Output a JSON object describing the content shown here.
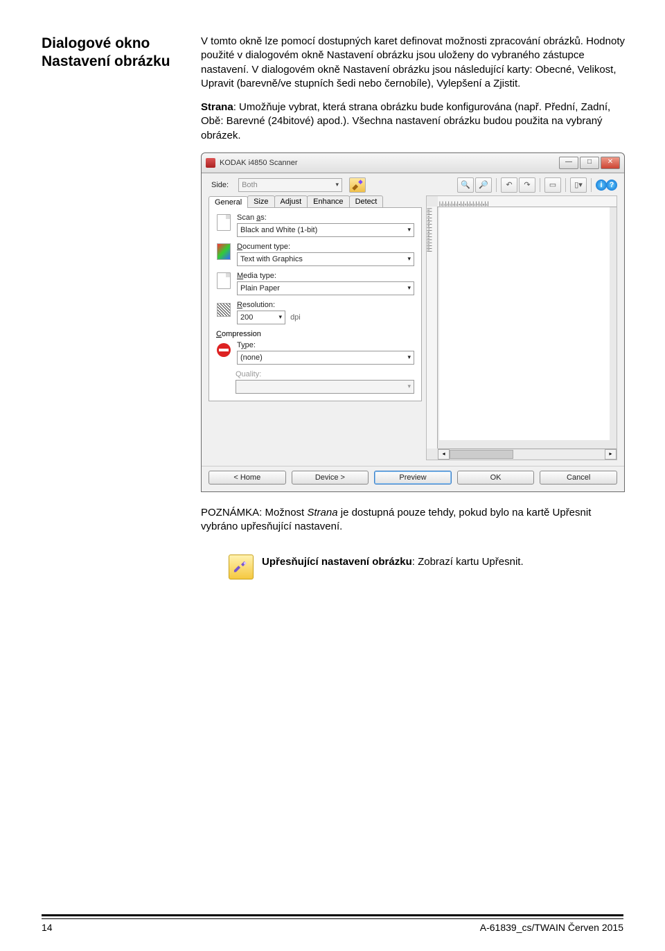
{
  "heading_line1": "Dialogové okno",
  "heading_line2": "Nastavení obrázku",
  "para1": "V tomto okně lze pomocí dostupných karet definovat možnosti zpracování obrázků. Hodnoty použité v dialogovém okně Nastavení obrázku jsou uloženy do vybraného zástupce nastavení. V dialogovém okně Nastavení obrázku jsou následující karty: Obecné, Velikost, Upravit (barevně/ve stupních šedi nebo černobíle), Vylepšení a Zjistit.",
  "para2_pre": "Strana",
  "para2_mid": ": Umožňuje vybrat, která strana obrázku bude konfigurována (např. Přední, Zadní, Obě: Barevné (24bitové) apod.). Všechna nastavení obrázku budou použita na vybraný obrázek.",
  "window": {
    "title": "KODAK i4850 Scanner",
    "side_label": "Side:",
    "side_value": "Both",
    "tabs": [
      "General",
      "Size",
      "Adjust",
      "Enhance",
      "Detect"
    ],
    "scan_as_label": "Scan as:",
    "scan_as_value": "Black and White (1-bit)",
    "doc_type_label": "Document type:",
    "doc_type_value": "Text with Graphics",
    "media_label": "Media type:",
    "media_value": "Plain Paper",
    "res_label": "Resolution:",
    "res_value": "200",
    "dpi": "dpi",
    "compression_label": "Compression",
    "type_label": "Type:",
    "type_value": "(none)",
    "quality_label": "Quality:",
    "ruler_h": "|₁|₁|₂|₁|₃|₁|₄|₁|₅|₁|₆|₁|₇|₁|₈|₁|",
    "ruler_v": "|₁|₂|₃|₄|₅|₆|₇|₈|₉|₁|₁|₁|₁|₁|",
    "buttons": {
      "home": "< Home",
      "device": "Device >",
      "preview": "Preview",
      "ok": "OK",
      "cancel": "Cancel"
    }
  },
  "note_label": "POZNÁMKA: ",
  "note_body_pre": "Možnost ",
  "note_body_em": "Strana",
  "note_body_post": " je dostupná pouze tehdy, pokud bylo na kartě Upřesnit vybráno upřesňující nastavení.",
  "advset_b": "Upřesňující nastavení obrázku",
  "advset_rest": ": Zobrazí kartu Upřesnit.",
  "footer_left": "14",
  "footer_right": "A-61839_cs/TWAIN  Červen 2015"
}
